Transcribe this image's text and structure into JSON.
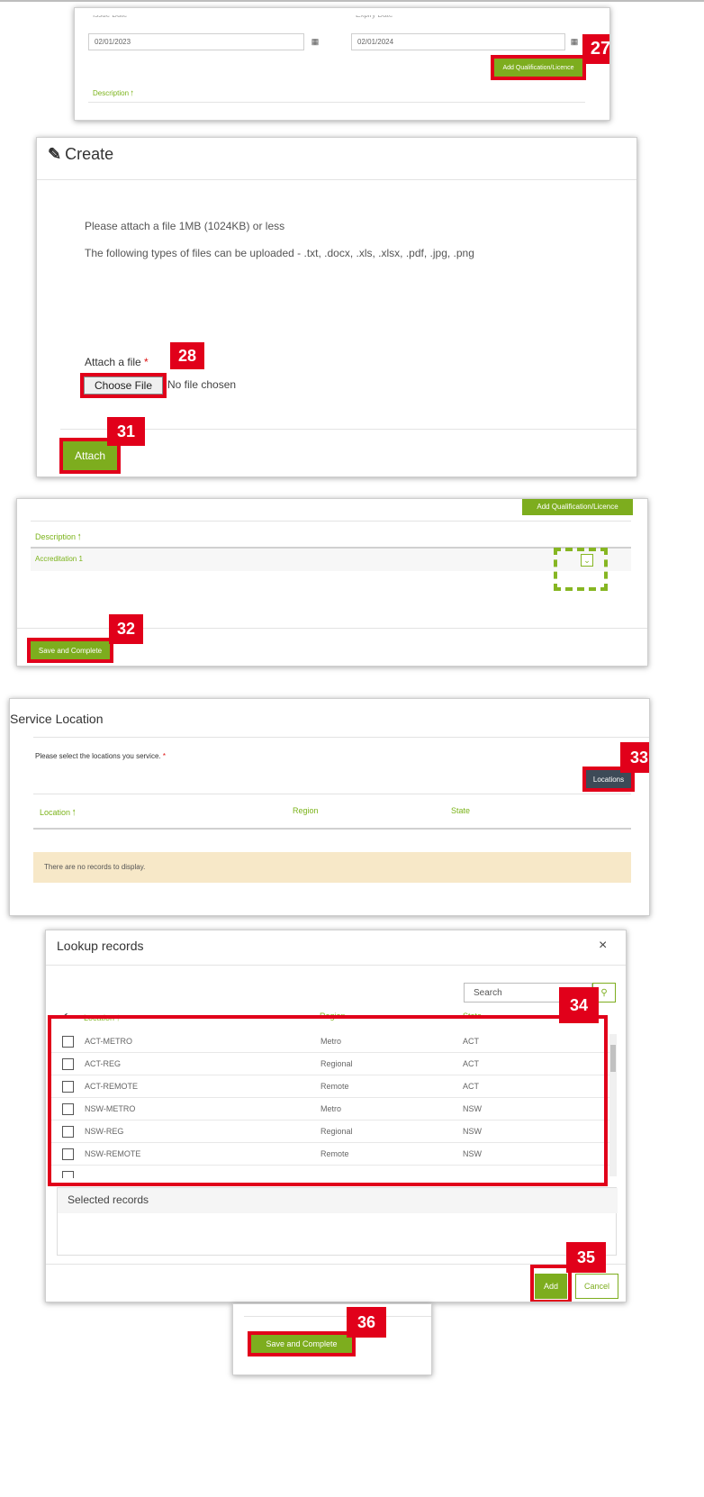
{
  "panel1": {
    "issue_date_label": "Issue Date",
    "issue_date_value": "02/01/2023",
    "expiry_date_label": "Expiry Date",
    "expiry_date_value": "02/01/2024",
    "add_button": "Add Qualification/Licence",
    "badge": "27",
    "col_description": "Description"
  },
  "panel2": {
    "title": "Create",
    "info_line1": "Please attach a file 1MB (1024KB) or less",
    "info_line2": "The following types of files can be uploaded - .txt, .docx, .xls, .xlsx, .pdf, .jpg, .png",
    "attach_label": "Attach a file",
    "required_mark": "*",
    "choose_file": "Choose File",
    "no_file": "No file chosen",
    "attach_button": "Attach",
    "badge_choose": "28",
    "badge_attach": "31"
  },
  "panel3": {
    "add_button": "Add Qualification/Licence",
    "col_description": "Description",
    "row_value": "Accreditation 1",
    "save_button": "Save and Complete",
    "badge": "32"
  },
  "panel4": {
    "title": "Service Location",
    "prompt": "Please select the locations you service.",
    "required_mark": "*",
    "locations_button": "Locations",
    "badge": "33",
    "columns": [
      "Location",
      "Region",
      "State"
    ],
    "empty_message": "There are no records to display."
  },
  "panel5": {
    "title": "Lookup records",
    "close": "×",
    "search_placeholder": "Search",
    "columns": [
      "Location",
      "Region",
      "State"
    ],
    "rows": [
      {
        "location": "ACT-METRO",
        "region": "Metro",
        "state": "ACT"
      },
      {
        "location": "ACT-REG",
        "region": "Regional",
        "state": "ACT"
      },
      {
        "location": "ACT-REMOTE",
        "region": "Remote",
        "state": "ACT"
      },
      {
        "location": "NSW-METRO",
        "region": "Metro",
        "state": "NSW"
      },
      {
        "location": "NSW-REG",
        "region": "Regional",
        "state": "NSW"
      },
      {
        "location": "NSW-REMOTE",
        "region": "Remote",
        "state": "NSW"
      }
    ],
    "selected_records": "Selected records",
    "add_button": "Add",
    "cancel_button": "Cancel",
    "badge_list": "34",
    "badge_add": "35"
  },
  "panel6": {
    "save_button": "Save and Complete",
    "badge": "36"
  },
  "colors": {
    "accent_green": "#7dad1e",
    "annotation_red": "#e1001a",
    "empty_banner": "#f7e8c8",
    "dark_button": "#3d4a57"
  }
}
